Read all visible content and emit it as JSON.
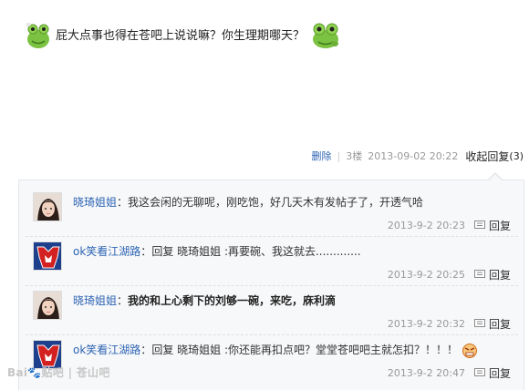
{
  "post": {
    "text": "屁大点事也得在苍吧上说说嘛？你生理期哪天？",
    "delete_label": "删除",
    "separator": "|",
    "floor": "3楼",
    "time": "2013-09-02 20:22",
    "collapse_label": "收起回复",
    "reply_count": "(3)"
  },
  "replies": [
    {
      "user": "晓琦姐姐",
      "colon": "：",
      "text": "我这会闲的无聊呢，刚吃饱，好几天木有发帖子了，开透气哈",
      "time": "2013-9-2 20:23",
      "reply_label": "回复",
      "avatar_icon": "girl-portrait"
    },
    {
      "user": "ok笑看江湖路",
      "colon": "：",
      "text": "回复 晓琦姐姐 :再要碗、我这就去.............",
      "time": "2013-9-2 20:25",
      "reply_label": "回复",
      "avatar_icon": "autobot-logo"
    },
    {
      "user": "晓琦姐姐",
      "colon": "：",
      "text": "我的和上心剩下的刘够一碗，来吃，庥利滴",
      "time": "2013-9-2 20:32",
      "reply_label": "回复",
      "avatar_icon": "girl-portrait"
    },
    {
      "user": "ok笑看江湖路",
      "colon": "：",
      "text": "回复 晓琦姐姐 :你还能再扣点吧？堂堂苍吧吧主就怎扣？！！！",
      "time": "2013-9-2 20:47",
      "reply_label": "回复",
      "avatar_icon": "autobot-logo"
    }
  ],
  "watermark": "Bai🐾贴吧 | 苍山吧",
  "colors": {
    "link_blue": "#2d64b3",
    "panel_bg": "#f7f8fa",
    "frog_green": "#7cc242"
  }
}
